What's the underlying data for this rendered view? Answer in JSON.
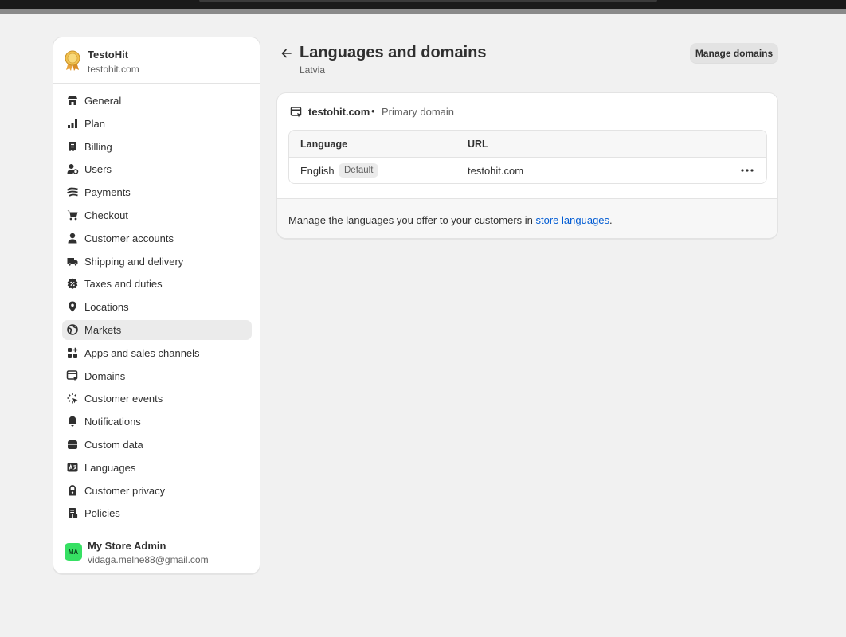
{
  "store": {
    "name": "TestoHit",
    "domain": "testohit.com"
  },
  "nav": [
    {
      "key": "general",
      "label": "General",
      "icon": "store-icon"
    },
    {
      "key": "plan",
      "label": "Plan",
      "icon": "plan-chart-icon"
    },
    {
      "key": "billing",
      "label": "Billing",
      "icon": "receipt-icon"
    },
    {
      "key": "users",
      "label": "Users",
      "icon": "user-gear-icon"
    },
    {
      "key": "payments",
      "label": "Payments",
      "icon": "payment-icon"
    },
    {
      "key": "checkout",
      "label": "Checkout",
      "icon": "cart-icon"
    },
    {
      "key": "customer-accounts",
      "label": "Customer accounts",
      "icon": "person-icon"
    },
    {
      "key": "shipping",
      "label": "Shipping and delivery",
      "icon": "truck-icon"
    },
    {
      "key": "taxes",
      "label": "Taxes and duties",
      "icon": "tax-icon"
    },
    {
      "key": "locations",
      "label": "Locations",
      "icon": "location-pin-icon"
    },
    {
      "key": "markets",
      "label": "Markets",
      "icon": "globe-icon"
    },
    {
      "key": "apps",
      "label": "Apps and sales channels",
      "icon": "apps-icon"
    },
    {
      "key": "domains",
      "label": "Domains",
      "icon": "domain-icon"
    },
    {
      "key": "customer-events",
      "label": "Customer events",
      "icon": "sparkle-cursor-icon"
    },
    {
      "key": "notifications",
      "label": "Notifications",
      "icon": "bell-icon"
    },
    {
      "key": "custom-data",
      "label": "Custom data",
      "icon": "database-icon"
    },
    {
      "key": "languages",
      "label": "Languages",
      "icon": "language-icon"
    },
    {
      "key": "customer-privacy",
      "label": "Customer privacy",
      "icon": "lock-icon"
    },
    {
      "key": "policies",
      "label": "Policies",
      "icon": "policy-document-icon"
    }
  ],
  "active_nav": "markets",
  "user": {
    "initials": "MA",
    "name": "My Store Admin",
    "email": "vidaga.melne88@gmail.com"
  },
  "page": {
    "title": "Languages and domains",
    "subtitle": "Latvia",
    "manage_button": "Manage domains"
  },
  "card": {
    "domain": "testohit.com",
    "separator": "•",
    "domain_type": "Primary domain",
    "table": {
      "headers": [
        "Language",
        "URL"
      ],
      "rows": [
        {
          "language": "English",
          "badge": "Default",
          "url": "testohit.com"
        }
      ]
    },
    "footer": {
      "text_before": "Manage the languages you offer to your customers in ",
      "link": "store languages",
      "text_after": "."
    }
  },
  "colors": {
    "background": "#f1f1f1",
    "link": "#005bd3",
    "avatar": "#36e063",
    "active_nav": "#ebebeb"
  }
}
